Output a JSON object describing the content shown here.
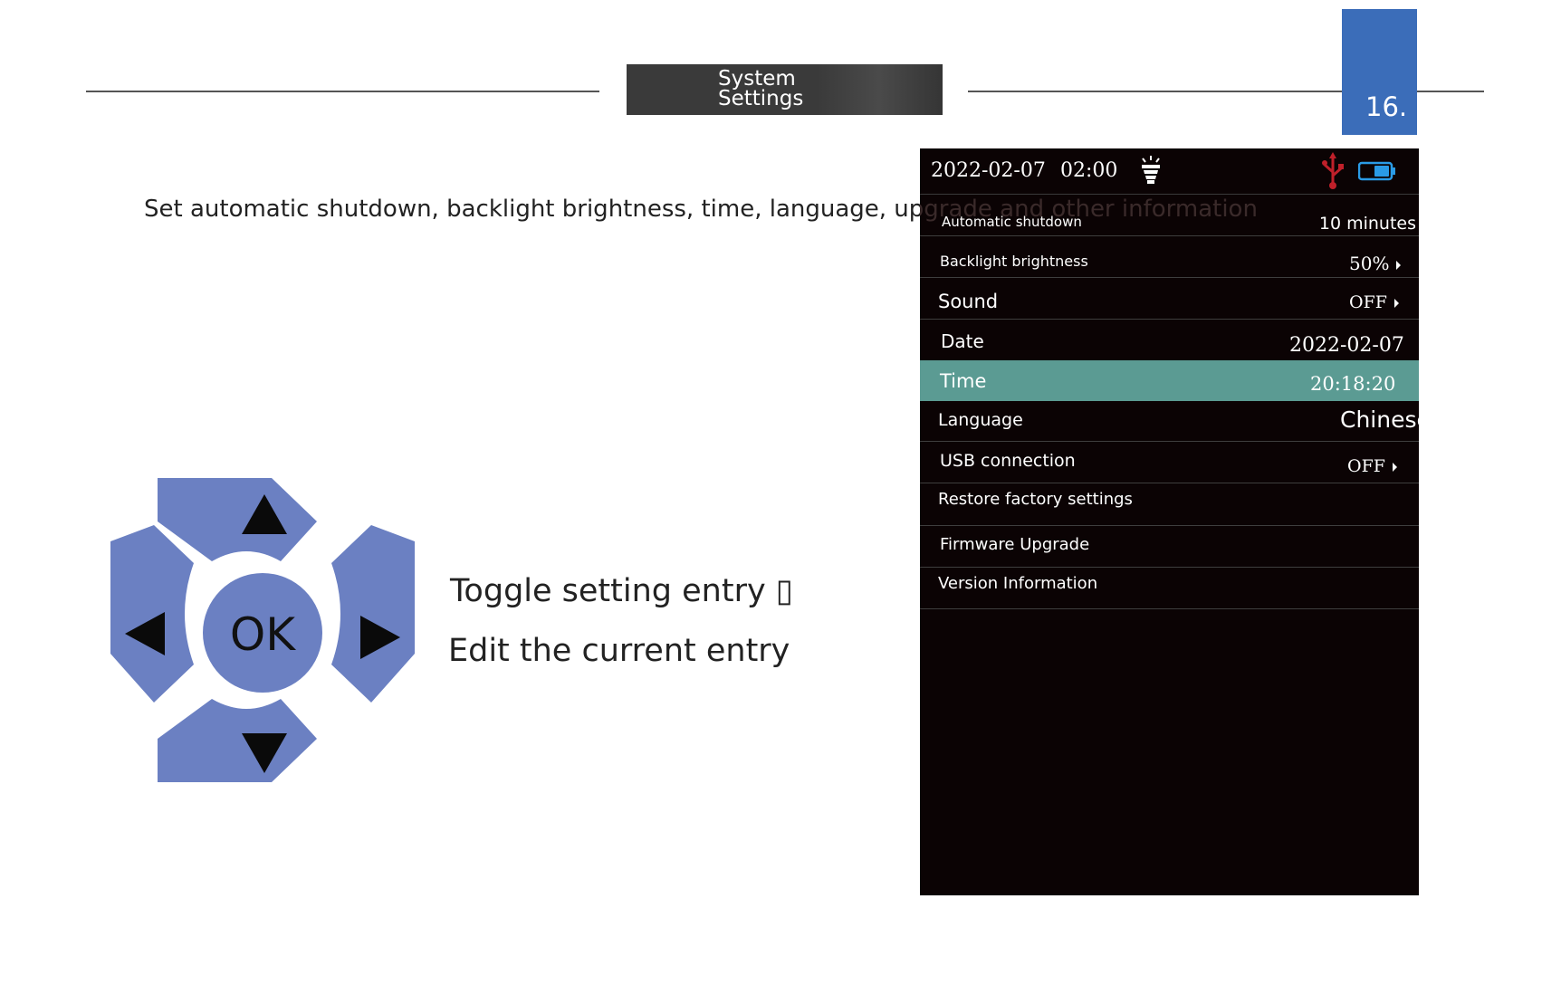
{
  "header": {
    "title_line1": "System",
    "title_line2": "Settings",
    "page_number": "16."
  },
  "intro_text": "Set automatic shutdown, backlight brightness, time, language, upgrade and other information",
  "dpad": {
    "center_label": "OK",
    "color": "#6b80c2"
  },
  "instructions": {
    "line1": "Toggle setting entry ▯",
    "line2": "Edit the current entry"
  },
  "device": {
    "status_bar": {
      "date": "2022-02-07",
      "time": "02:00",
      "battery_color": "#2a9be6",
      "usb_color": "#c0202a"
    },
    "settings": [
      {
        "label": "Automatic shutdown",
        "value": "10 minutes"
      },
      {
        "label": "Backlight brightness",
        "value": "50%"
      },
      {
        "label": "Sound",
        "value": "OFF"
      },
      {
        "label": "Date",
        "value": "2022-02-07"
      },
      {
        "label": "Time",
        "value": "20:18:20",
        "selected": true
      },
      {
        "label": "Language",
        "value": "Chinese"
      },
      {
        "label": "USB connection",
        "value": "OFF"
      },
      {
        "label": "Restore factory settings",
        "value": ""
      },
      {
        "label": "Firmware Upgrade",
        "value": ""
      },
      {
        "label": "Version Information",
        "value": ""
      }
    ],
    "selected_color": "#5b9b93"
  }
}
